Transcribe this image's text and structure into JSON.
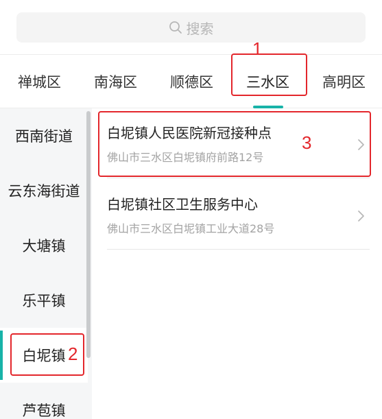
{
  "search": {
    "placeholder": "搜索"
  },
  "tabs": [
    {
      "label": "禅城区",
      "active": false
    },
    {
      "label": "南海区",
      "active": false
    },
    {
      "label": "顺德区",
      "active": false
    },
    {
      "label": "三水区",
      "active": true
    },
    {
      "label": "高明区",
      "active": false
    }
  ],
  "sidebar": {
    "items": [
      {
        "label": "西南街道",
        "active": false
      },
      {
        "label": "云东海街道",
        "active": false
      },
      {
        "label": "大塘镇",
        "active": false
      },
      {
        "label": "乐平镇",
        "active": false
      },
      {
        "label": "白坭镇",
        "active": true
      },
      {
        "label": "芦苞镇",
        "active": false
      }
    ]
  },
  "locations": [
    {
      "name": "白坭镇人民医院新冠接种点",
      "address": "佛山市三水区白坭镇府前路12号"
    },
    {
      "name": "白坭镇社区卫生服务中心",
      "address": "佛山市三水区白坭镇工业大道28号"
    }
  ],
  "annotations": {
    "mark1": "1",
    "mark2": "2",
    "mark3": "3"
  },
  "colors": {
    "accent": "#18b3a8",
    "annotation": "#e3262b"
  }
}
